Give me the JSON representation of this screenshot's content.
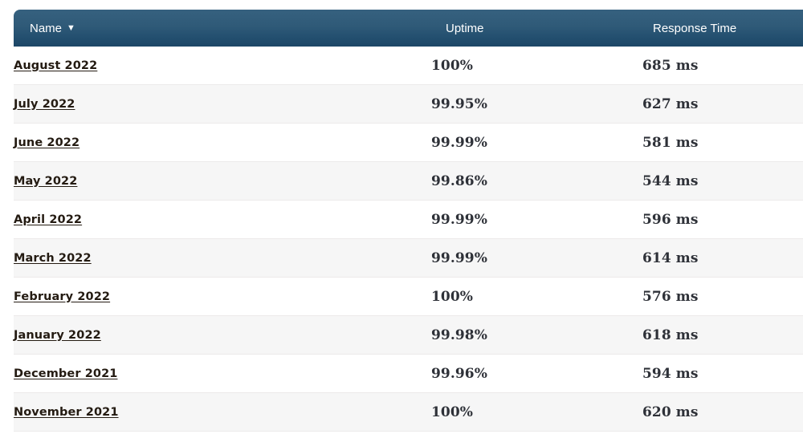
{
  "table": {
    "columns": [
      {
        "key": "name",
        "label": "Name",
        "sort_indicator": "▼",
        "sorted": true
      },
      {
        "key": "uptime",
        "label": "Uptime",
        "sort_indicator": "",
        "sorted": false
      },
      {
        "key": "response",
        "label": "Response Time",
        "sort_indicator": "",
        "sorted": false
      }
    ],
    "rows": [
      {
        "name": "August 2022",
        "uptime": "100%",
        "response": "685 ms"
      },
      {
        "name": "July 2022",
        "uptime": "99.95%",
        "response": "627 ms"
      },
      {
        "name": "June 2022",
        "uptime": "99.99%",
        "response": "581 ms"
      },
      {
        "name": "May 2022",
        "uptime": "99.86%",
        "response": "544 ms"
      },
      {
        "name": "April 2022",
        "uptime": "99.99%",
        "response": "596 ms"
      },
      {
        "name": "March 2022",
        "uptime": "99.99%",
        "response": "614 ms"
      },
      {
        "name": "February 2022",
        "uptime": "100%",
        "response": "576 ms"
      },
      {
        "name": "January 2022",
        "uptime": "99.98%",
        "response": "618 ms"
      },
      {
        "name": "December 2021",
        "uptime": "99.96%",
        "response": "594 ms"
      },
      {
        "name": "November 2021",
        "uptime": "100%",
        "response": "620 ms"
      }
    ]
  },
  "colors": {
    "header_gradient_top": "#36617f",
    "header_gradient_bottom": "#1d4767",
    "header_text": "#ffffff",
    "row_odd_bg": "#ffffff",
    "row_even_bg": "#f6f6f6",
    "row_border": "#eceaea",
    "link_text": "#241b12",
    "value_text": "#2e3138"
  }
}
